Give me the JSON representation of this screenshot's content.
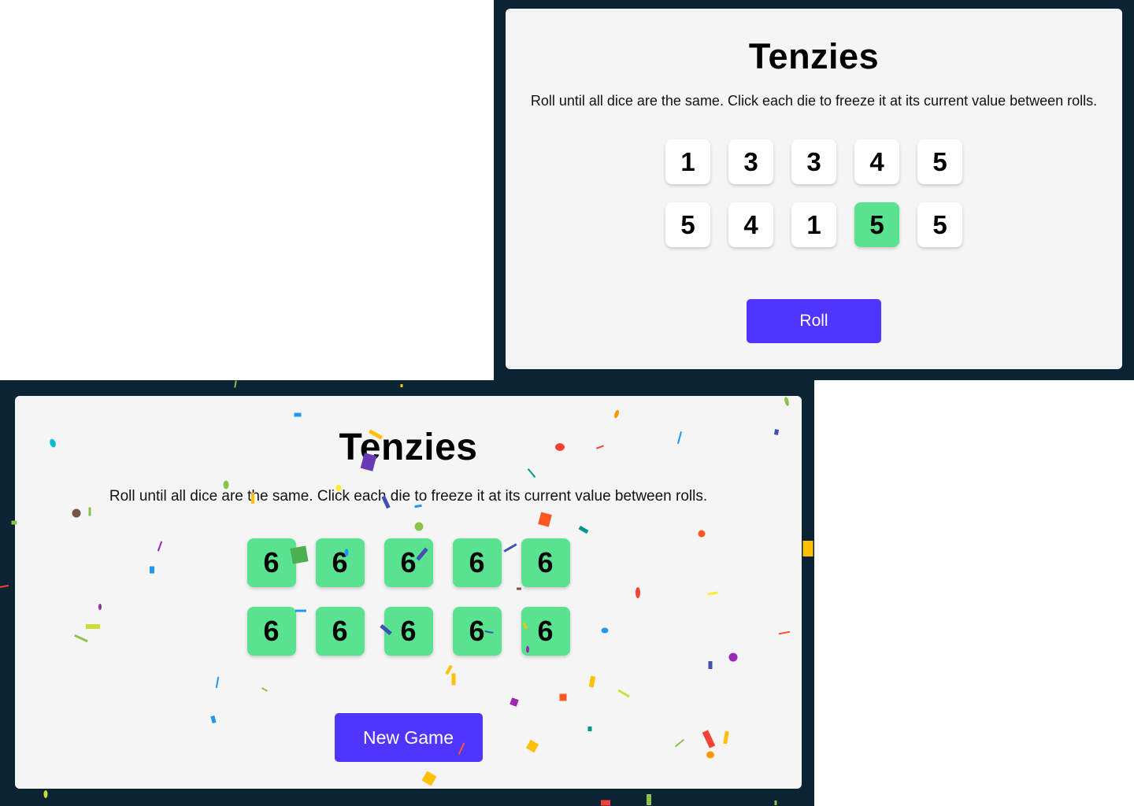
{
  "top_screen": {
    "title": "Tenzies",
    "instructions": "Roll until all dice are the same. Click each die to freeze it at its current value between rolls.",
    "dice": [
      {
        "value": "1",
        "held": false
      },
      {
        "value": "3",
        "held": false
      },
      {
        "value": "3",
        "held": false
      },
      {
        "value": "4",
        "held": false
      },
      {
        "value": "5",
        "held": false
      },
      {
        "value": "5",
        "held": false
      },
      {
        "value": "4",
        "held": false
      },
      {
        "value": "1",
        "held": false
      },
      {
        "value": "5",
        "held": true
      },
      {
        "value": "5",
        "held": false
      }
    ],
    "button_label": "Roll"
  },
  "bottom_screen": {
    "title": "Tenzies",
    "instructions": "Roll until all dice are the same. Click each die to freeze it at its current value between rolls.",
    "dice": [
      {
        "value": "6",
        "held": true
      },
      {
        "value": "6",
        "held": true
      },
      {
        "value": "6",
        "held": true
      },
      {
        "value": "6",
        "held": true
      },
      {
        "value": "6",
        "held": true
      },
      {
        "value": "6",
        "held": true
      },
      {
        "value": "6",
        "held": true
      },
      {
        "value": "6",
        "held": true
      },
      {
        "value": "6",
        "held": true
      },
      {
        "value": "6",
        "held": true
      }
    ],
    "button_label": "New Game"
  },
  "colors": {
    "page_background": "#0b2434",
    "card_background": "#f5f5f5",
    "held_die": "#59e391",
    "free_die": "#ffffff",
    "button": "#5035ff",
    "confetti": [
      "#00bcd4",
      "#ff9800",
      "#f44336",
      "#ffc107",
      "#8bc34a",
      "#9c27b0",
      "#3f51b5",
      "#2196f3",
      "#4caf50",
      "#795548",
      "#cddc39",
      "#009688",
      "#673ab7",
      "#ff5722",
      "#ffeb3b",
      "#03a9f4"
    ]
  }
}
